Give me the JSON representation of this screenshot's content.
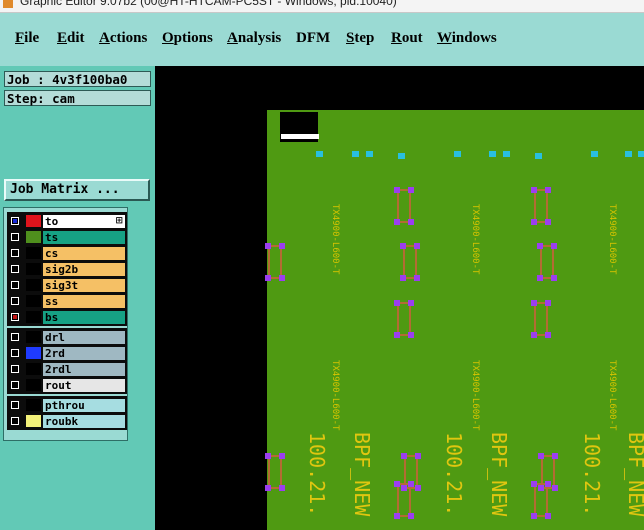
{
  "window": {
    "title": "Graphic Editor 9.07b2 (00@HT-HTCAM-PC5ST - Windows, pid:10040)"
  },
  "menu": [
    {
      "label": "File",
      "u": "F",
      "rest": "ile"
    },
    {
      "label": "Edit",
      "u": "E",
      "rest": "dit"
    },
    {
      "label": "Actions",
      "u": "A",
      "rest": "ctions"
    },
    {
      "label": "Options",
      "u": "O",
      "rest": "ptions"
    },
    {
      "label": "Analysis",
      "u": "A",
      "rest": "nalysis"
    },
    {
      "label": "DFM",
      "u": "",
      "rest": "DFM"
    },
    {
      "label": "Step",
      "u": "S",
      "rest": "tep"
    },
    {
      "label": "Rout",
      "u": "R",
      "rest": "out"
    },
    {
      "label": "Windows",
      "u": "W",
      "rest": "indows"
    }
  ],
  "info": {
    "job": "Job : 4v3f100ba0",
    "step": "Step: cam"
  },
  "job_matrix_label": "Job Matrix ...",
  "layers": {
    "group1": [
      {
        "name": "to",
        "color": "#ffffff",
        "swatch": "#e0141c",
        "check": "#1a2bd8"
      },
      {
        "name": "ts",
        "color": "#16a184",
        "swatch": "#4f8f1d",
        "check": "#000000"
      },
      {
        "name": "cs",
        "color": "#f5c065",
        "swatch": "#000000",
        "check": "#000000"
      },
      {
        "name": "sig2b",
        "color": "#f5c065",
        "swatch": "#000000",
        "check": "#000000"
      },
      {
        "name": "sig3t",
        "color": "#f5c065",
        "swatch": "#000000",
        "check": "#000000"
      },
      {
        "name": "ss",
        "color": "#f5c065",
        "swatch": "#000000",
        "check": "#000000"
      },
      {
        "name": "bs",
        "color": "#16a184",
        "swatch": "#000000",
        "check": "#c21515"
      }
    ],
    "group2": [
      {
        "name": "drl",
        "color": "#9fb8c2",
        "swatch": "#000000",
        "check": "#000000"
      },
      {
        "name": "2rd",
        "color": "#9fb8c2",
        "swatch": "#1f3bff",
        "check": "#000000"
      },
      {
        "name": "2rdl",
        "color": "#9fb8c2",
        "swatch": "#000000",
        "check": "#000000"
      },
      {
        "name": "rout",
        "color": "#e6e6e6",
        "swatch": "#000000",
        "check": "#000000"
      }
    ],
    "group3": [
      {
        "name": "pthrou",
        "color": "#a6dde1",
        "swatch": "#000000",
        "check": "#000000"
      },
      {
        "name": "roubk",
        "color": "#a6dde1",
        "swatch": "#f4f27a",
        "check": "#000000"
      }
    ]
  },
  "board": {
    "silk_small": "TX4900-L600-T",
    "silk_small_b": "TX4900-L600-T",
    "silk_num": "100.21.",
    "silk_name": "BPF_NEW",
    "colors": {
      "board": "#4f9a12",
      "pad": "#29bfe0",
      "outline": "#b36b33",
      "via": "#9b3ef0",
      "silk": "#d6c300",
      "silk_num": "#e0c610"
    }
  }
}
